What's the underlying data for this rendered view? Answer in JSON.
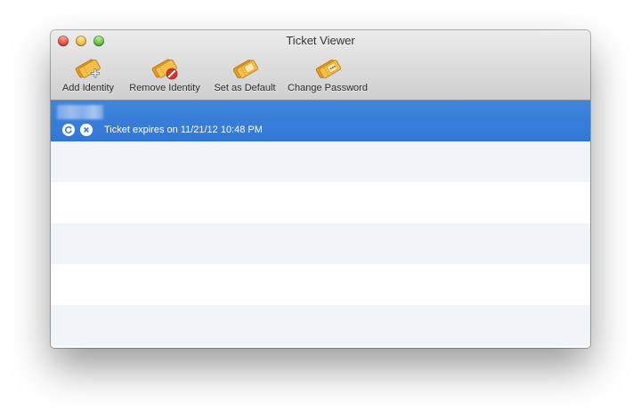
{
  "window": {
    "title": "Ticket Viewer"
  },
  "toolbar": {
    "items": [
      {
        "label": "Add Identity",
        "icon": "ticket-add-icon"
      },
      {
        "label": "Remove Identity",
        "icon": "ticket-remove-icon"
      },
      {
        "label": "Set as Default",
        "icon": "ticket-default-icon"
      },
      {
        "label": "Change Password",
        "icon": "ticket-password-icon"
      }
    ]
  },
  "list": {
    "selected": {
      "identity": "",
      "expiry_text": "Ticket expires on 11/21/12 10:48 PM",
      "icons": [
        "renew-icon",
        "destroy-icon"
      ]
    }
  },
  "colors": {
    "selection": "#3479d8",
    "alt_row": "#f1f5fa",
    "ticket": "#f0b43a"
  }
}
